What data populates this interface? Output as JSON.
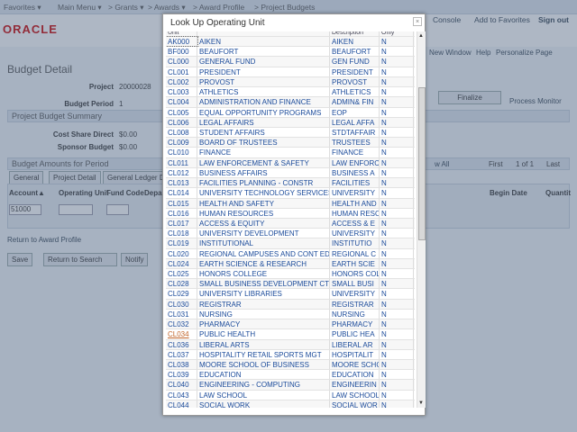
{
  "nav": {
    "favorites": "Favorites ▾",
    "main_menu": "Main Menu ▾",
    "grants": "> Grants ▾",
    "awards": "> Awards ▾",
    "award_profile": "> Award Profile",
    "project_budgets": "> Project Budgets"
  },
  "header": {
    "logo": "ORACLE",
    "console": "Console",
    "add_favorites": "Add to Favorites",
    "sign_out": "Sign out",
    "new_window": "New Window",
    "help": "Help",
    "personalize": "Personalize Page"
  },
  "page": {
    "title": "Budget Detail",
    "project_label": "Project",
    "project_value": "20000028",
    "period_label": "Budget Period",
    "period_value": "1",
    "finalize": "Finalize",
    "process_monitor": "Process Monitor",
    "summary": "Project Budget Summary",
    "cost_share_label": "Cost Share Direct",
    "cost_share_value": "$0.00",
    "sponsor_label": "Sponsor Budget",
    "sponsor_value": "$0.00",
    "amounts": "Budget Amounts for Period",
    "tabs": [
      "General",
      "Project Detail",
      "General Ledger D"
    ],
    "cols": [
      "Account▲",
      "Operating Unit",
      "Fund Code",
      "Depar"
    ],
    "begin_date": "Begin Date",
    "quantity": "Quantit",
    "account_value": "51000",
    "view_all": "w All",
    "first": "First",
    "of": "1 of 1",
    "last": "Last",
    "return_link": "Return to Award Profile",
    "save": "Save",
    "return_search": "Return to Search",
    "notify": "Notify"
  },
  "modal": {
    "title": "Look Up Operating Unit",
    "close": "×",
    "headers": [
      "Unit",
      "",
      "Description",
      "Only"
    ],
    "rows": [
      [
        "AK000",
        "AIKEN",
        "AIKEN",
        "N"
      ],
      [
        "BF000",
        "BEAUFORT",
        "BEAUFORT",
        "N"
      ],
      [
        "CL000",
        "GENERAL FUND",
        "GEN FUND",
        "N"
      ],
      [
        "CL001",
        "PRESIDENT",
        "PRESIDENT",
        "N"
      ],
      [
        "CL002",
        "PROVOST",
        "PROVOST",
        "N"
      ],
      [
        "CL003",
        "ATHLETICS",
        "ATHLETICS",
        "N"
      ],
      [
        "CL004",
        "ADMINISTRATION AND FINANCE",
        "ADMIN& FIN",
        "N"
      ],
      [
        "CL005",
        "EQUAL OPPORTUNITY PROGRAMS",
        "EOP",
        "N"
      ],
      [
        "CL006",
        "LEGAL AFFAIRS",
        "LEGAL AFFA",
        "N"
      ],
      [
        "CL008",
        "STUDENT AFFAIRS",
        "STDTAFFAIR",
        "N"
      ],
      [
        "CL009",
        "BOARD OF TRUSTEES",
        "TRUSTEES",
        "N"
      ],
      [
        "CL010",
        "FINANCE",
        "FINANCE",
        "N"
      ],
      [
        "CL011",
        "LAW ENFORCEMENT & SAFETY",
        "LAW ENFORC",
        "N"
      ],
      [
        "CL012",
        "BUSINESS AFFAIRS",
        "BUSINESS A",
        "N"
      ],
      [
        "CL013",
        "FACILITIES PLANNING - CONSTR",
        "FACILITIES",
        "N"
      ],
      [
        "CL014",
        "UNIVERSITY TECHNOLOGY SERVICES",
        "UNIVERSITY",
        "N"
      ],
      [
        "CL015",
        "HEALTH AND SAFETY",
        "HEALTH AND",
        "N"
      ],
      [
        "CL016",
        "HUMAN RESOURCES",
        "HUMAN RESO",
        "N"
      ],
      [
        "CL017",
        "ACCESS & EQUITY",
        "ACCESS & E",
        "N"
      ],
      [
        "CL018",
        "UNIVERSITY DEVELOPMENT",
        "UNIVERSITY",
        "N"
      ],
      [
        "CL019",
        "INSTITUTIONAL",
        "INSTITUTIO",
        "N"
      ],
      [
        "CL020",
        "REGIONAL CAMPUSES AND CONT ED",
        "REGIONAL C",
        "N"
      ],
      [
        "CL024",
        "EARTH SCIENCE & RESEARCH",
        "EARTH SCIE",
        "N"
      ],
      [
        "CL025",
        "HONORS COLLEGE",
        "HONORS COL",
        "N"
      ],
      [
        "CL028",
        "SMALL BUSINESS DEVELOPMENT CTR",
        "SMALL BUSI",
        "N"
      ],
      [
        "CL029",
        "UNIVERSITY LIBRARIES",
        "UNIVERSITY",
        "N"
      ],
      [
        "CL030",
        "REGISTRAR",
        "REGISTRAR",
        "N"
      ],
      [
        "CL031",
        "NURSING",
        "NURSING",
        "N"
      ],
      [
        "CL032",
        "PHARMACY",
        "PHARMACY",
        "N"
      ],
      [
        "CL034",
        "PUBLIC HEALTH",
        "PUBLIC HEA",
        "N"
      ],
      [
        "CL036",
        "LIBERAL ARTS",
        "LIBERAL AR",
        "N"
      ],
      [
        "CL037",
        "HOSPITALITY RETAIL SPORTS MGT",
        "HOSPITALIT",
        "N"
      ],
      [
        "CL038",
        "MOORE SCHOOL OF BUSINESS",
        "MOORE SCHO",
        "N"
      ],
      [
        "CL039",
        "EDUCATION",
        "EDUCATION",
        "N"
      ],
      [
        "CL040",
        "ENGINEERING - COMPUTING",
        "ENGINEERIN",
        "N"
      ],
      [
        "CL043",
        "LAW SCHOOL",
        "LAW SCHOOL",
        "N"
      ],
      [
        "CL044",
        "SOCIAL WORK",
        "SOCIAL WOR",
        "N"
      ]
    ],
    "hovered_unit": "CL034",
    "link_color": "#1a4a9a",
    "hover_color": "#c0652a"
  }
}
